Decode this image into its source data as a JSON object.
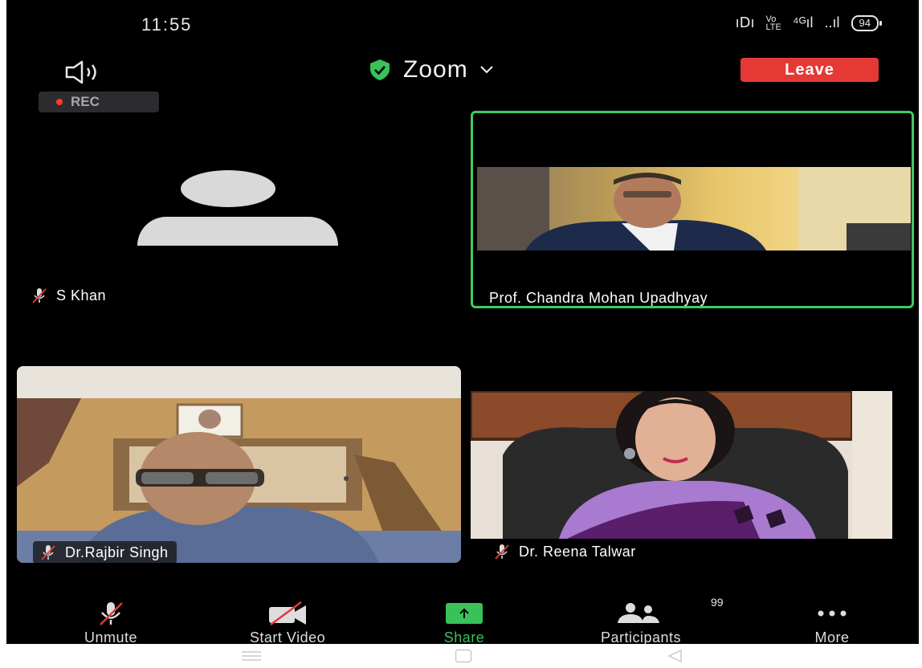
{
  "status_bar": {
    "time": "11:55",
    "icons": [
      "vibrate-icon",
      "volte-icon",
      "4g-signal-icon",
      "signal-icon"
    ],
    "battery": "94"
  },
  "top_bar": {
    "speaker_icon": "speaker-icon",
    "meeting_title": "Zoom",
    "leave_label": "Leave",
    "rec_label": "REC"
  },
  "participants": [
    {
      "name": "S Khan",
      "video": false,
      "muted": true
    },
    {
      "name": "Prof. Chandra Mohan Upadhyay",
      "video": true,
      "muted": false,
      "active_speaker": true
    },
    {
      "name": "Dr.Rajbir Singh",
      "video": true,
      "muted": true
    },
    {
      "name": "Dr. Reena Talwar",
      "video": true,
      "muted": true
    }
  ],
  "toolbar": {
    "unmute_label": "Unmute",
    "start_video_label": "Start Video",
    "share_label": "Share",
    "participants_label": "Participants",
    "participants_count": "99",
    "more_label": "More"
  },
  "colors": {
    "accent_green": "#39c15a",
    "leave_red": "#e53935",
    "speaker_border": "#3ecc5f",
    "rec_dot": "#ff3b30"
  }
}
